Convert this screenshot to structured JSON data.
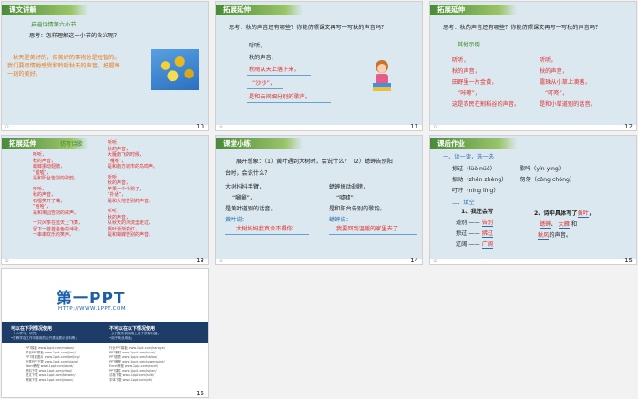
{
  "slides": {
    "s10": {
      "number": "10",
      "header": "课文讲解",
      "subheading": "启迪诗情第六小节",
      "question": "思考：怎样理解这一小节的含义呢？",
      "para1": "秋天是美好的，但美好的事物总是短暂的。",
      "para2": "我们要尽情地感受和聆听秋天的声音，把握每",
      "para3": "一刻的美好。"
    },
    "s11": {
      "number": "11",
      "header": "拓展延伸",
      "question": "思考：秋的声音还有哪些？你能仿照课文再写一写秋的声音吗？",
      "lines": [
        "听听，",
        "秋的声音，",
        "秋雨从天上落下来，",
        "“沙沙”，",
        "是和云间细分别的歌声。"
      ]
    },
    "s12": {
      "number": "12",
      "header": "拓展延伸",
      "question": "思考：秋的声音还有哪些？你能仿照课文再写一写秋的声音吗？",
      "subheading": "其他示例",
      "col1": [
        "听听，",
        "秋的声音，",
        "田野里一片金黄，",
        "“咔嚓”，",
        "这是农民在割稻谷的声音。"
      ],
      "col2": [
        "听听，",
        "秋的声音，",
        "露珠从小草上滴落，",
        "“叮咚”，",
        "是和小草道别的话音。"
      ]
    },
    "s13": {
      "number": "13",
      "header": "拓展延伸",
      "subheading": "仿写诗歌",
      "col1": [
        "听听，",
        "秋的声音，",
        "蟋蟀振动翅膀，",
        "“嘘嘘”，",
        "是和阳台告别的歌韵。",
        "",
        "听听，",
        "秋的声音，",
        "石榴笑开了嘴，",
        "“哈哈”，",
        "是和果园告别的歌声。",
        "",
        "一只风筝在蓝天上飞舞，",
        "留下一首首金色的诗歌，",
        "一串串欢乐的笑声。"
      ],
      "col2": [
        "听听，",
        "秋的声音，",
        "大雁南飞的时候，",
        "“嘎嘎”，",
        "是和南方城市的鸟鸣声。",
        "",
        "听听，",
        "秋的声音，",
        "苹果一个个熟了，",
        "“扑通”，",
        "是和大地告别的声音。",
        "",
        "听听，",
        "秋的声音，",
        "从秋天的河流里走过，",
        "枫叶渐渐变红，",
        "是和蝴蝶告别的声音。"
      ]
    },
    "s14": {
      "number": "14",
      "header": "课堂小练",
      "prompt1": "展开想象：（1）黄叶遇到大树时，会说什么？（2）蟋蟀告别阳",
      "prompt2": "台时，会说什么？",
      "left": [
        "大树抖抖手臂，",
        "“唰唰”，",
        "是黄叶道别的话音。"
      ],
      "left_label": "黄叶说：",
      "left_answer": "大树妈妈我真舍不得你",
      "right": [
        "蟋蟀振动翅膀，",
        "“嘘嘘”，",
        "是和阳台告别的歌韵。"
      ],
      "right_label": "蟋蟀说：",
      "right_answer": "我要回到温暖的家里去了"
    },
    "s15": {
      "number": "15",
      "header": "课后作业",
      "task1": "一、读一读，选一选",
      "pinyin": [
        [
          "掠过（",
          "lüè",
          " nüè",
          "）",
          "歌吟（",
          "yín",
          " yíng",
          "）"
        ],
        [
          "振动（",
          "zhēn",
          " zhèng",
          "）",
          "匆匆（",
          "cōng",
          " chōng",
          "）"
        ],
        [
          "叮咛（",
          "níng",
          " líng",
          "）",
          "",
          "",
          "",
          ""
        ]
      ],
      "task2": "二、填空",
      "fill_title": "1、我还会写",
      "fill": [
        [
          "道别",
          "告别"
        ],
        [
          "掠过",
          "拂过"
        ],
        [
          "辽阔",
          "广阔"
        ]
      ],
      "fill2_title": "2、诗中具体写了",
      "fill2_word": "黄叶",
      "fill2_a": "蟋蟀",
      "fill2_b": "大雁",
      "fill2_and": "和",
      "fill2_c": "秋风",
      "fill2_end": "的声音。"
    },
    "s16": {
      "number": "16",
      "logo": "第一PPT",
      "url": "HTTP://WWW.1PPT.COM",
      "can_use": "可以在下列情况使用",
      "cannot_use": "不可以在以下情况使用",
      "can_items": [
        "•个人学习、研究；",
        "•在教学及工作中使用的公开类及展示资料等；"
      ],
      "cannot_items": [
        "•公开发布到网络上用于获取利益；",
        "•用于商业用途；"
      ],
      "links_left": [
        "PPT模板 www.1ppt.com/moban/",
        "节日PPT模板 www.1ppt.com/jieri/",
        "PPT背景图片 www.1ppt.com/beijing/",
        "优秀PPT下载 www.1ppt.com/xiazai/",
        "Word教程 www.1ppt.com/word/",
        "资料下载 www.1ppt.com/ziliao/",
        "范文下载 www.1ppt.com/fanwen/",
        "教案下载 www.1ppt.com/jiaoan/"
      ],
      "links_right": [
        "行业PPT模板 www.1ppt.com/hangye/",
        "PPT素材 www.1ppt.com/sucai/",
        "PPT图表 www.1ppt.com/tubiao/",
        "PPT教程 www.1ppt.com/powerpoint/",
        "Excel教程 www.1ppt.com/excel/",
        "PPT课件 www.1ppt.com/kejian/",
        "试卷下载 www.1ppt.com/shiti/",
        "字体下载 www.1ppt.com/ziti/"
      ]
    }
  }
}
